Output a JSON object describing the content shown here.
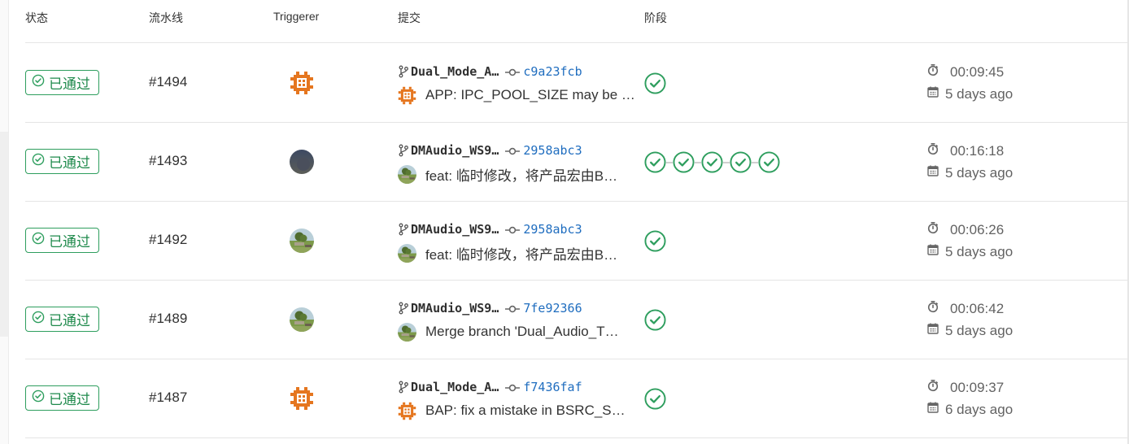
{
  "header": {
    "status": "状态",
    "pipeline": "流水线",
    "triggerer": "Triggerer",
    "commit": "提交",
    "stages": "阶段"
  },
  "colors": {
    "success": "#2e9e5e",
    "link": "#1f6dbf",
    "pipeline_avatar": "#e5761f"
  },
  "rows": [
    {
      "status": "已通过",
      "pipeline": "#1494",
      "triggerer_avatar": "orange-identicon",
      "branch": "Dual_Mode_A…",
      "sha": "c9a23fcb",
      "author_avatar": "orange-identicon",
      "message": "APP: IPC_POOL_SIZE may be …",
      "stages": 1,
      "duration": "00:09:45",
      "finished": "5 days ago"
    },
    {
      "status": "已通过",
      "pipeline": "#1493",
      "triggerer_avatar": "dark-photo",
      "branch": "DMAudio_WS9…",
      "sha": "2958abc3",
      "author_avatar": "landscape-photo",
      "message": "feat: 临时修改，将产品宏由B…",
      "stages": 5,
      "duration": "00:16:18",
      "finished": "5 days ago"
    },
    {
      "status": "已通过",
      "pipeline": "#1492",
      "triggerer_avatar": "landscape-photo",
      "branch": "DMAudio_WS9…",
      "sha": "2958abc3",
      "author_avatar": "landscape-photo",
      "message": "feat: 临时修改，将产品宏由B…",
      "stages": 1,
      "duration": "00:06:26",
      "finished": "5 days ago"
    },
    {
      "status": "已通过",
      "pipeline": "#1489",
      "triggerer_avatar": "landscape-photo",
      "branch": "DMAudio_WS9…",
      "sha": "7fe92366",
      "author_avatar": "landscape-photo",
      "message": "Merge branch 'Dual_Audio_T…",
      "stages": 1,
      "duration": "00:06:42",
      "finished": "5 days ago"
    },
    {
      "status": "已通过",
      "pipeline": "#1487",
      "triggerer_avatar": "orange-identicon",
      "branch": "Dual_Mode_A…",
      "sha": "f7436faf",
      "author_avatar": "orange-identicon",
      "message": "BAP: fix a mistake in BSRC_S…",
      "stages": 1,
      "duration": "00:09:37",
      "finished": "6 days ago"
    }
  ]
}
